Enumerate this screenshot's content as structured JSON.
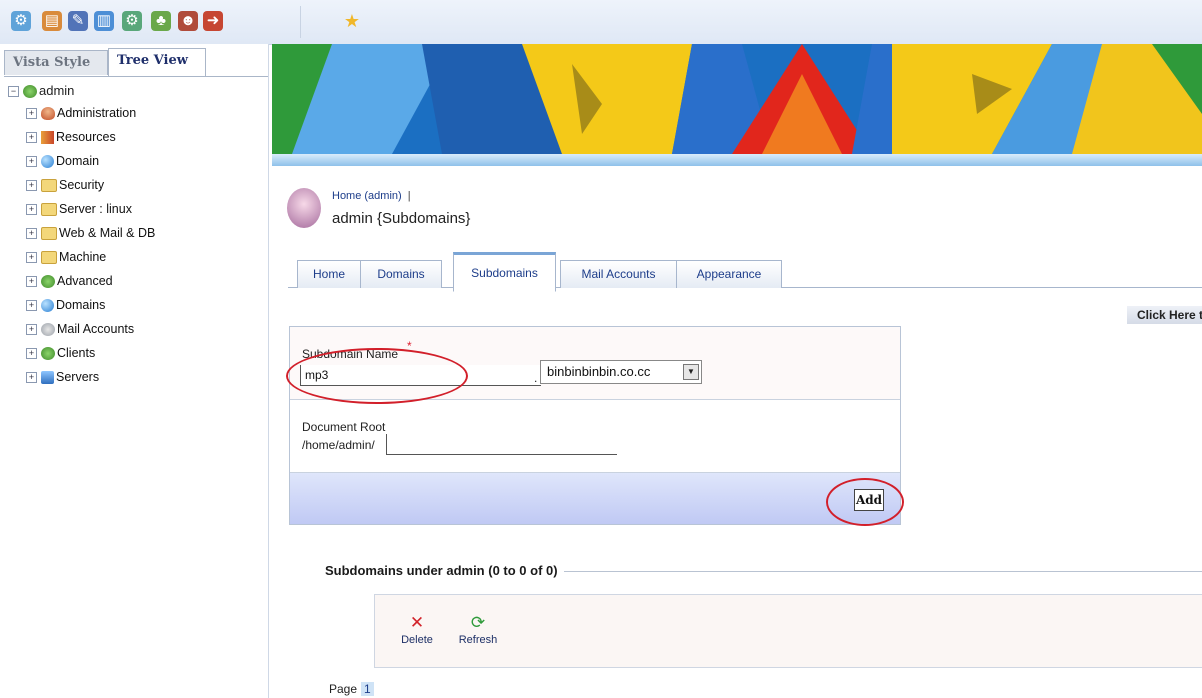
{
  "sidebar": {
    "tabs": [
      {
        "label": "Vista Style",
        "active": false
      },
      {
        "label": "Tree View",
        "active": true
      }
    ],
    "root": "admin",
    "items": [
      {
        "label": "Administration",
        "icon": "people-icon"
      },
      {
        "label": "Resources",
        "icon": "book-icon"
      },
      {
        "label": "Domain",
        "icon": "globe-icon"
      },
      {
        "label": "Security",
        "icon": "folder-icon"
      },
      {
        "label": "Server : linux",
        "icon": "folder-icon"
      },
      {
        "label": "Web & Mail & DB",
        "icon": "folder-icon"
      },
      {
        "label": "Machine",
        "icon": "folder-icon"
      },
      {
        "label": "Advanced",
        "icon": "gear-icon"
      },
      {
        "label": "Domains",
        "icon": "globe-icon"
      },
      {
        "label": "Mail Accounts",
        "icon": "grey-icon"
      },
      {
        "label": "Clients",
        "icon": "gear-icon"
      },
      {
        "label": "Servers",
        "icon": "server-icon"
      }
    ]
  },
  "header": {
    "breadcrumb": "Home (admin)",
    "breadcrumb_sep": "|",
    "title": "admin {Subdomains}"
  },
  "tabs": [
    {
      "label": "Home",
      "active": false
    },
    {
      "label": "Domains",
      "active": false
    },
    {
      "label": "Subdomains",
      "active": true
    },
    {
      "label": "Mail Accounts",
      "active": false
    },
    {
      "label": "Appearance",
      "active": false
    }
  ],
  "click_here": "Click Here to",
  "form": {
    "subdomain_label": "Subdomain Name",
    "required_mark": "*",
    "subdomain_value": "mp3",
    "dot": ".",
    "domain_selected": "binbinbinbin.co.cc",
    "docroot_label": "Document Root",
    "docroot_prefix": "/home/admin/",
    "docroot_value": "",
    "add_label": "Add"
  },
  "list": {
    "title": "Subdomains under admin (0 to 0 of 0)",
    "actions": [
      {
        "label": "Delete",
        "icon": "delete-icon",
        "glyph": "✕",
        "color": "#d2232a"
      },
      {
        "label": "Refresh",
        "icon": "refresh-icon",
        "glyph": "⟳",
        "color": "#2e9a3a"
      }
    ],
    "page_label": "Page",
    "page_current": "1"
  },
  "toolbar": {
    "icons": [
      "gear-icon",
      "book-icon",
      "tools-icon",
      "server-icon",
      "gear-icon",
      "tree-icon",
      "user-icon",
      "exit-icon",
      "star-icon"
    ]
  },
  "colors": {
    "accent": "#1d3d8a",
    "annotation_red": "#d21f2a"
  }
}
